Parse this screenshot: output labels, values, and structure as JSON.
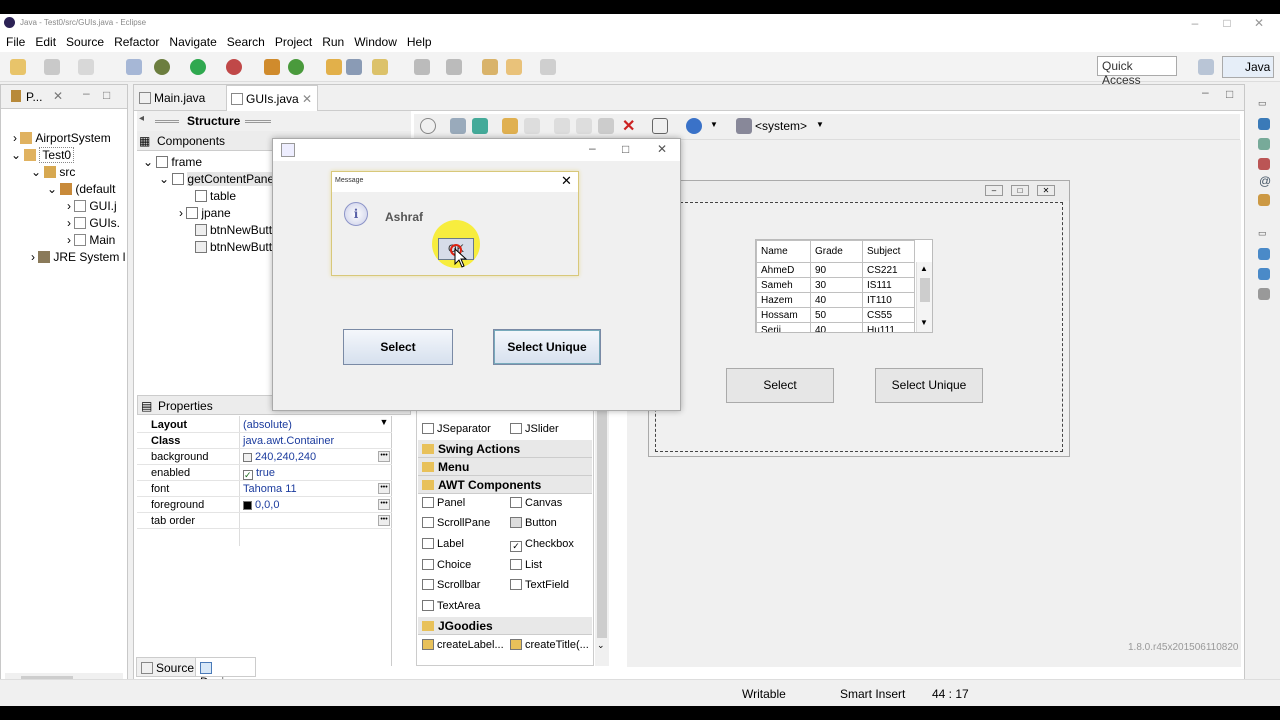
{
  "window": {
    "title": "Java - Test0/src/GUIs.java - Eclipse"
  },
  "menu": [
    "File",
    "Edit",
    "Source",
    "Refactor",
    "Navigate",
    "Search",
    "Project",
    "Run",
    "Window",
    "Help"
  ],
  "toolbar": {
    "quick_access": "Quick Access",
    "perspective": "Java"
  },
  "explorer": {
    "tab": "P...",
    "items": {
      "airport": "AirportSystem",
      "test0": "Test0",
      "src": "src",
      "default": "(default",
      "gui1": "GUI.j",
      "guis": "GUIs.",
      "main": "Main",
      "jre": "JRE System l"
    }
  },
  "editor_tabs": {
    "main": "Main.java",
    "guis": "GUIs.java"
  },
  "structure": {
    "title": "Structure",
    "components": "Components",
    "tree": {
      "frame": "frame",
      "content": "getContentPane",
      "table": "table",
      "jpane": "jpane",
      "btn1": "btnNewButt",
      "btn2": "btnNewButt"
    }
  },
  "properties": {
    "title": "Properties",
    "rows": [
      {
        "k": "Layout",
        "v": "(absolute)",
        "bold": true
      },
      {
        "k": "Class",
        "v": "java.awt.Container",
        "bold": true
      },
      {
        "k": "background",
        "v": "240,240,240"
      },
      {
        "k": "enabled",
        "v": "true"
      },
      {
        "k": "font",
        "v": "Tahoma 11"
      },
      {
        "k": "foreground",
        "v": "0,0,0"
      },
      {
        "k": "tab order",
        "v": ""
      }
    ]
  },
  "palette": {
    "row1a": "JSeparator",
    "row1b": "JSlider",
    "swing_actions": "Swing Actions",
    "menu": "Menu",
    "awt": "AWT Components",
    "items": [
      "Panel",
      "Canvas",
      "ScrollPane",
      "Button",
      "Label",
      "Checkbox",
      "Choice",
      "List",
      "Scrollbar",
      "TextField",
      "TextArea"
    ],
    "jgoodies": "JGoodies",
    "jg1": "createLabel...",
    "jg2": "createTitle(..."
  },
  "designer": {
    "system": "<system>",
    "version": "1.8.0.r45x201506110820"
  },
  "table": {
    "headers": [
      "Name",
      "Grade",
      "Subject"
    ],
    "rows": [
      [
        "AhmeD",
        "90",
        "CS221"
      ],
      [
        "Sameh",
        "30",
        "IS111"
      ],
      [
        "Hazem",
        "40",
        "IT110"
      ],
      [
        "Hossam",
        "50",
        "CS55"
      ],
      [
        "Serij",
        "40",
        "Hu111"
      ]
    ]
  },
  "design_buttons": {
    "select": "Select",
    "select_unique": "Select Unique"
  },
  "running_frame": {
    "select": "Select",
    "select_unique": "Select Unique"
  },
  "message": {
    "title": "Message",
    "text": "Ashraf",
    "ok": "OK"
  },
  "bottom_tabs": {
    "source": "Source",
    "design": "Design"
  },
  "status": {
    "writable": "Writable",
    "insert": "Smart Insert",
    "pos": "44 : 17"
  }
}
